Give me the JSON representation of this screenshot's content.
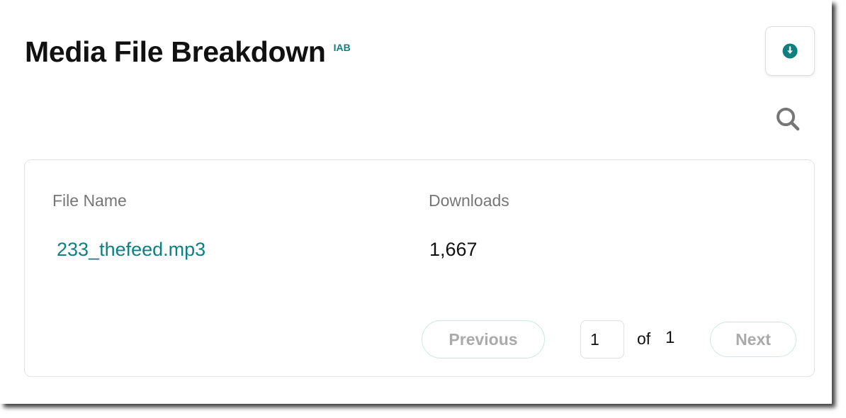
{
  "header": {
    "title": "Media File Breakdown",
    "badge": "IAB"
  },
  "toolbar": {
    "download_icon": "download-circle-icon",
    "search_icon": "search-icon"
  },
  "table": {
    "columns": [
      "File Name",
      "Downloads"
    ],
    "rows": [
      {
        "file_name": "233_thefeed.mp3",
        "downloads": "1,667"
      }
    ]
  },
  "pagination": {
    "previous_label": "Previous",
    "current_page": "1",
    "of_label": "of",
    "total_pages": "1",
    "next_label": "Next"
  },
  "colors": {
    "accent": "#0f8080",
    "text": "#111111",
    "muted": "#767676",
    "disabled": "#aaaaaa",
    "border": "#e2e2e2"
  }
}
